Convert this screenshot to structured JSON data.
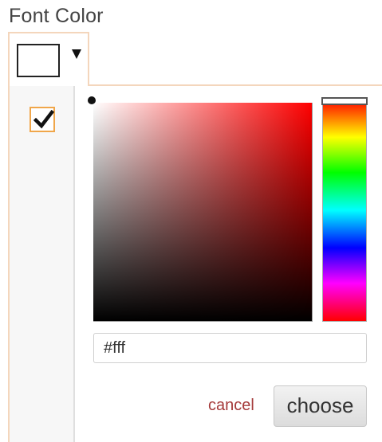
{
  "label": "Font Color",
  "current_color": "#ffffff",
  "hex_input_value": "#fff",
  "hue": "red",
  "checkbox_checked": true,
  "cancel_label": "cancel",
  "choose_label": "choose",
  "icons": {
    "caret": "caret-down-icon",
    "check": "checkmark-icon"
  },
  "colors": {
    "accent_border": "#f4d6bc",
    "checkbox_border": "#f0a64a",
    "cancel_text": "#a53a3a"
  }
}
